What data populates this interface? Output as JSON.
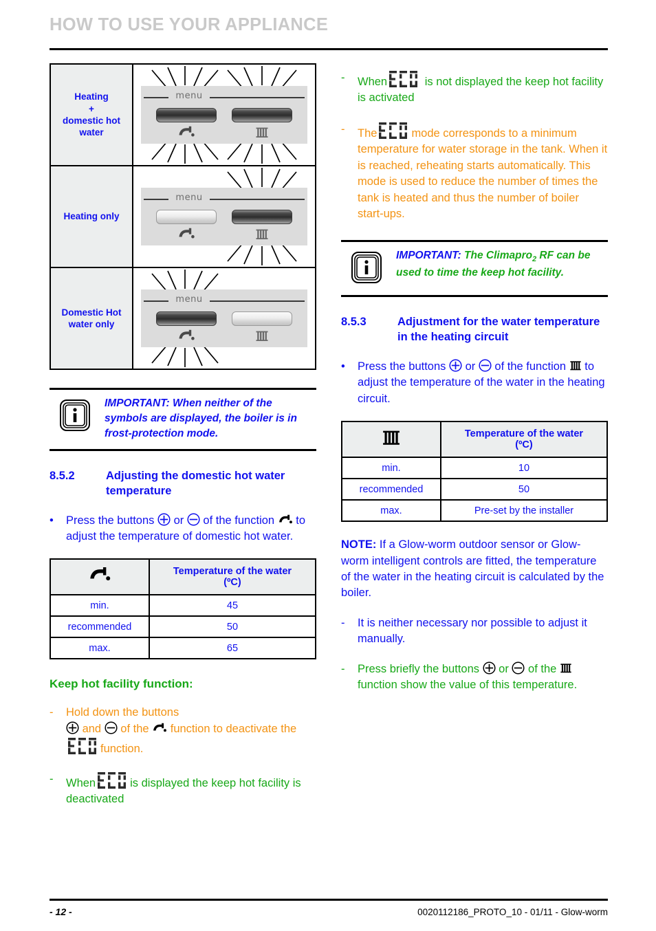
{
  "header": {
    "title": "HOW TO USE YOUR APPLIANCE"
  },
  "colors": {
    "blue": "#1111ee",
    "green": "#18a818",
    "orange": "#f39313",
    "header_grey": "#c9c9c9",
    "table_header_bg": "#eceeee",
    "lcd_bg": "#dcdcdc"
  },
  "modes_table": {
    "rows": [
      {
        "label": "Heating\n+\ndomestic hot\nwater",
        "label_lines": [
          "Heating",
          "+",
          "domestic hot",
          "water"
        ],
        "menu_text": "menu",
        "dhw_bar": "on",
        "heating_bar": "on",
        "dhw_blinking": true,
        "heating_blinking": true
      },
      {
        "label": "Heating only",
        "label_lines": [
          "Heating only"
        ],
        "menu_text": "menu",
        "dhw_bar": "off",
        "heating_bar": "on",
        "dhw_blinking": false,
        "heating_blinking": true
      },
      {
        "label": "Domestic Hot\nwater only",
        "label_lines": [
          "Domestic Hot",
          "water only"
        ],
        "menu_text": "menu",
        "dhw_bar": "on",
        "heating_bar": "off",
        "dhw_blinking": true,
        "heating_blinking": false
      }
    ]
  },
  "left_info_box": {
    "lead": "IMPORTANT:",
    "body": " When neither of the symbols are displayed, the boiler is in frost-protection mode."
  },
  "section_852": {
    "number": "8.5.2",
    "title": "Adjusting the domestic hot water temperature",
    "bullet_part1": "Press the buttons ",
    "bullet_or": " or ",
    "bullet_part2": " of the function ",
    "bullet_part3": " to adjust the temperature of domestic hot water."
  },
  "dhw_table": {
    "header_icon": "tap-icon",
    "header_label_line1": "Temperature of the water",
    "header_label_line2": "(ºC)",
    "rows": [
      {
        "label": "min.",
        "value": "45"
      },
      {
        "label": "recommended",
        "value": "50"
      },
      {
        "label": "max.",
        "value": "65"
      }
    ]
  },
  "keep_hot": {
    "title": "Keep hot facility function:",
    "bullet1": {
      "marker": "-",
      "part1": "Hold down the buttons ",
      "and": " and ",
      "part2": " of the ",
      "part3": " function to deactivate the ",
      "eco": "ECO",
      "part4": "function."
    },
    "bullet2": {
      "marker": "-",
      "part1": "When",
      "eco": "ECO",
      "part2": "is displayed the keep hot facility is deactivated"
    }
  },
  "right_bullets_top": [
    {
      "marker": "-",
      "color": "green",
      "part1": "When",
      "eco": "ECO",
      "part2": " is not displayed the keep hot facility is activated"
    },
    {
      "marker": "-",
      "color": "orange",
      "part1": "The",
      "eco": "ECO",
      "part2": "mode corresponds to a minimum temperature for water storage in the tank. When it is reached, reheating starts automatically. This mode is used to reduce the number of times the tank is heated and thus the number of boiler start-ups."
    }
  ],
  "right_info_box": {
    "lead": "IMPORTANT:",
    "body_part1": " The Climapro",
    "body_sub": "2",
    "body_part2": " RF can be used to time the keep hot facility."
  },
  "section_853": {
    "number": "8.5.3",
    "title": "Adjustment for the water temperature in the heating circuit",
    "bullet_part1": "Press the buttons ",
    "bullet_or": " or ",
    "bullet_part2": " of the function ",
    "bullet_part3": " to adjust the temperature of the water in the heating circuit."
  },
  "heating_table": {
    "header_icon": "radiator-icon",
    "header_label_line1": "Temperature of the water",
    "header_label_line2": "(ºC)",
    "rows": [
      {
        "label": "min.",
        "value": "10"
      },
      {
        "label": "recommended",
        "value": "50"
      },
      {
        "label": "max.",
        "value": "Pre-set by the installer"
      }
    ]
  },
  "note": {
    "lead": "NOTE:",
    "body": " If a Glow-worm outdoor sensor or Glow-worm intelligent controls are fitted, the temperature of the water in the heating circuit is calculated by the boiler."
  },
  "right_bullets_bottom": [
    {
      "marker": "-",
      "color": "blue",
      "text": "It is neither necessary nor possible to adjust it manually."
    },
    {
      "marker": "-",
      "color": "green",
      "part1": "Press briefly the buttons ",
      "or": " or ",
      "part2": " of the ",
      "part3": " function show the value of this temperature."
    }
  ],
  "footer": {
    "page": "- 12 -",
    "reference": "0020112186_PROTO_10 - 01/11 - Glow-worm"
  }
}
